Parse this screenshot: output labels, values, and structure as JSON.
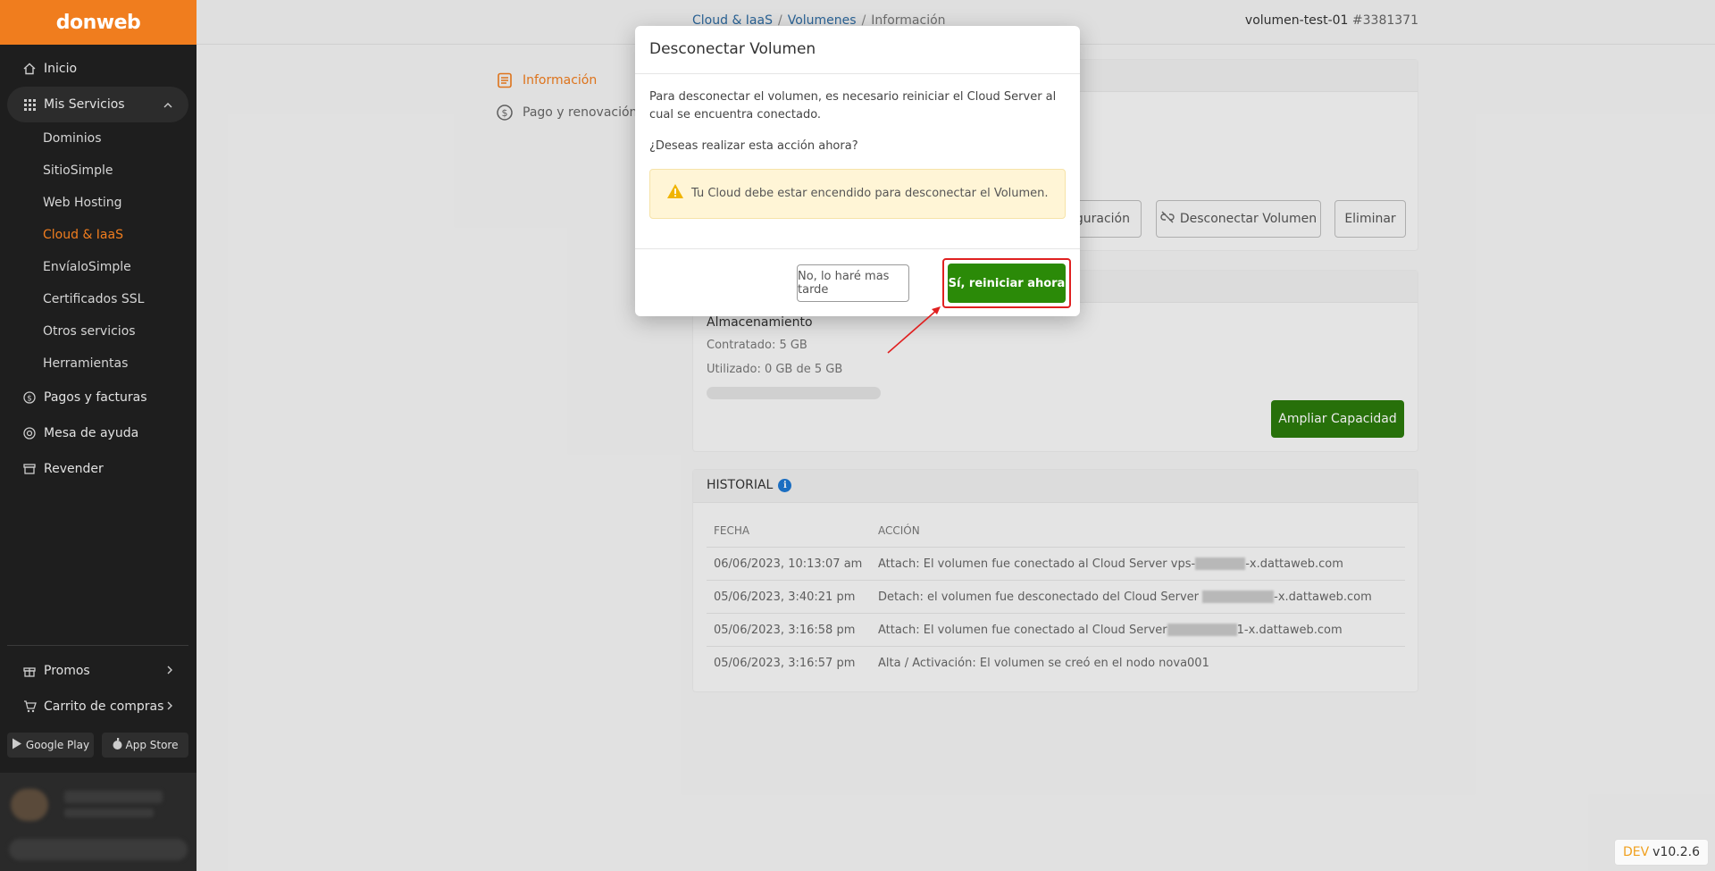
{
  "sidebar": {
    "logo": "donweb",
    "items": [
      {
        "label": "Inicio",
        "icon": "home-icon"
      },
      {
        "label": "Mis Servicios",
        "icon": "grid-icon"
      },
      {
        "label": "Pagos y facturas",
        "icon": "dollar-icon"
      },
      {
        "label": "Mesa de ayuda",
        "icon": "lifebuoy-icon"
      },
      {
        "label": "Revender",
        "icon": "store-icon"
      }
    ],
    "sub_items": [
      "Dominios",
      "SitioSimple",
      "Web Hosting",
      "Cloud & IaaS",
      "EnvíaloSimple",
      "Certificados SSL",
      "Otros servicios",
      "Herramientas"
    ],
    "current_sub": "Cloud & IaaS",
    "bottom": [
      {
        "label": "Promos",
        "icon": "gift-icon"
      },
      {
        "label": "Carrito de compras",
        "icon": "cart-icon"
      }
    ],
    "stores": {
      "google": "Google Play",
      "apple": "App Store"
    }
  },
  "header": {
    "breadcrumb": [
      "Cloud & IaaS",
      "Volumenes",
      "Información"
    ],
    "volume_name": "volumen-test-01",
    "volume_number": "#3381371"
  },
  "subnav": [
    {
      "label": "Información",
      "icon": "document-icon"
    },
    {
      "label": "Pago y renovación",
      "icon": "dollar-circle-icon"
    }
  ],
  "actions": {
    "config_partial": "iguración",
    "disconnect": "Desconectar Volumen",
    "delete": "Eliminar"
  },
  "storage": {
    "title": "Almacenamiento",
    "contracted": "Contratado: 5 GB",
    "used": "Utilizado: 0 GB de 5 GB",
    "used_fraction": 0,
    "expand_button": "Ampliar Capacidad"
  },
  "history": {
    "title": "HISTORIAL",
    "columns": [
      "FECHA",
      "ACCIÓN"
    ],
    "rows": [
      {
        "date": "06/06/2023, 10:13:07 am",
        "pre": "Attach: El volumen fue conectado al Cloud Server vps-",
        "post": "-x.dattaweb.com"
      },
      {
        "date": "05/06/2023, 3:40:21 pm",
        "pre": "Detach: el volumen fue desconectado del Cloud Server ",
        "post": "-x.dattaweb.com"
      },
      {
        "date": "05/06/2023, 3:16:58 pm",
        "pre": "Attach: El volumen fue conectado al Cloud Server",
        "post": "1-x.dattaweb.com"
      },
      {
        "date": "05/06/2023, 3:16:57 pm",
        "pre": "Alta / Activación: El volumen se creó en el nodo nova001",
        "post": ""
      }
    ]
  },
  "modal": {
    "title": "Desconectar Volumen",
    "body": "Para desconectar el volumen, es necesario reiniciar el Cloud Server al cual se encuentra conectado.",
    "question": "¿Deseas realizar esta acción ahora?",
    "warning": "Tu Cloud debe estar encendido para desconectar el Volumen.",
    "cancel": "No, lo haré mas tarde",
    "confirm": "Sí, reiniciar ahora"
  },
  "version": {
    "env": "DEV",
    "number": "v10.2.6"
  },
  "colors": {
    "brand": "#f07d1e",
    "confirm": "#2b8a08",
    "highlight": "#e02020",
    "link": "#2f6ca3"
  }
}
